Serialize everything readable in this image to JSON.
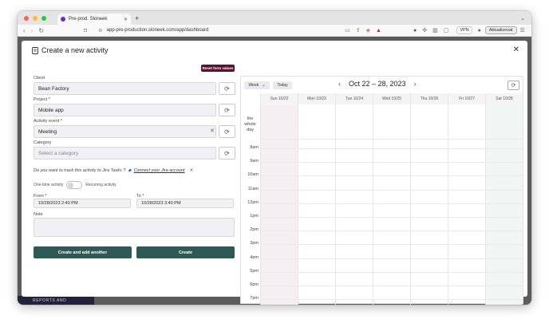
{
  "browser": {
    "tab_title": "Pre-prod. Sloneek",
    "url": "app-pre-production.sloneek.com/app/dashboard",
    "vpn_label": "VPN",
    "update_label": "Aktualizovat",
    "colors": {
      "red": "#fe5f57",
      "yellow": "#febc2e",
      "green": "#28c840"
    }
  },
  "backdrop": {
    "section_label": "REPORTS AND"
  },
  "modal": {
    "title": "Create a new activity",
    "reset_label": "Reset form values",
    "client": {
      "label": "Client",
      "value": "Bean Factory"
    },
    "project": {
      "label": "Project *",
      "value": "Mobile app"
    },
    "event": {
      "label": "Activity event *",
      "value": "Meeting"
    },
    "category": {
      "label": "Category",
      "placeholder": "Select a category"
    },
    "jira_question": "Do you want to track this activity to Jira Tasks ?",
    "jira_link": "Connect your Jira account",
    "toggle_left": "One-time activity",
    "toggle_right": "Recurring activity",
    "from": {
      "label": "From *",
      "value": "10/28/2023 2:40 PM"
    },
    "to": {
      "label": "To *",
      "value": "10/28/2023 3:40 PM"
    },
    "note_label": "Note",
    "btn_create_another": "Create and add another",
    "btn_create": "Create"
  },
  "calendar": {
    "view_label": "Week",
    "today_label": "Today",
    "range": "Oct 22 – 28, 2023",
    "days": [
      "Sun 10/22",
      "Mon 10/23",
      "Tue 10/24",
      "Wed 10/25",
      "Thu 10/26",
      "Fri 10/27",
      "Sat 10/28"
    ],
    "all_day": "the whole day",
    "times": [
      "8am",
      "9am",
      "10am",
      "11am",
      "12pm",
      "1pm",
      "2pm",
      "3pm",
      "4pm",
      "5pm",
      "6pm",
      "7pm"
    ],
    "colors": {
      "sunday": "#f5eff3",
      "saturday": "#eff6f3",
      "accent": "#2e5a56"
    }
  }
}
